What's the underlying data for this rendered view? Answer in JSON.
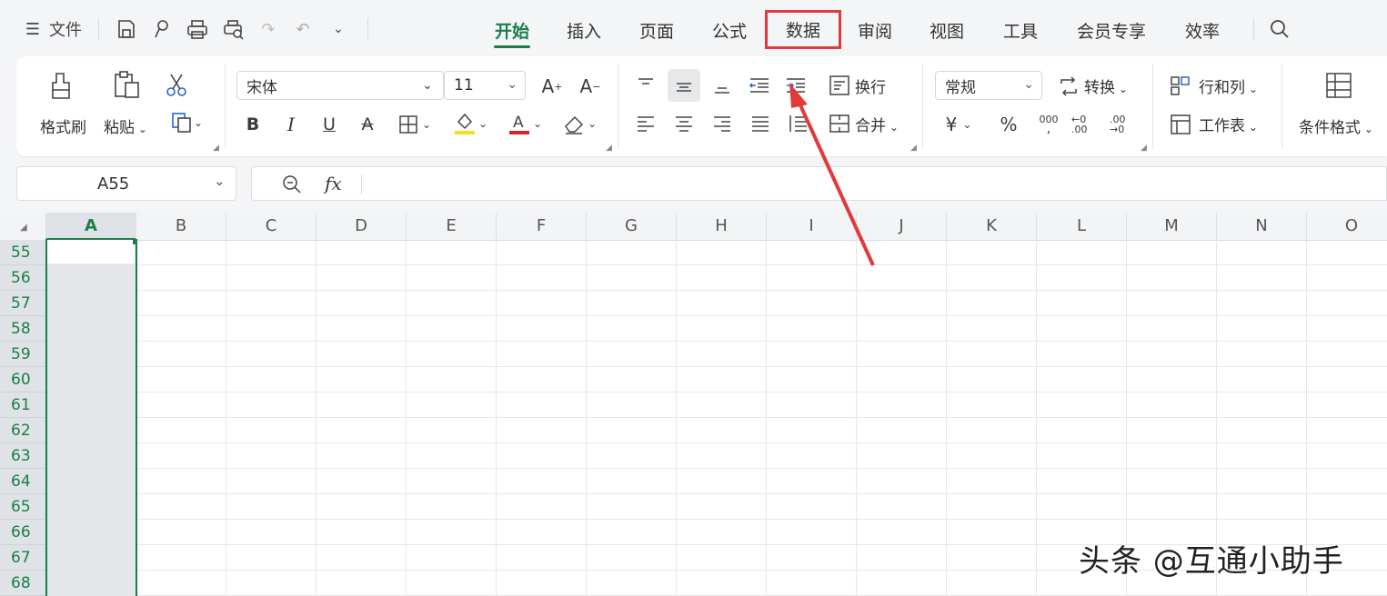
{
  "menu": {
    "file_label": "文件",
    "tabs": [
      "开始",
      "插入",
      "页面",
      "公式",
      "数据",
      "审阅",
      "视图",
      "工具",
      "会员专享",
      "效率"
    ],
    "active_tab": "开始",
    "highlighted_tab": "数据"
  },
  "ribbon": {
    "format_painter": "格式刷",
    "paste": "粘贴",
    "font_name": "宋体",
    "font_size": "11",
    "wrap_text": "换行",
    "merge": "合并",
    "number_format": "常规",
    "convert": "转换",
    "rows_cols": "行和列",
    "worksheet": "工作表",
    "conditional_format": "条件格式",
    "bold": "B",
    "italic": "I",
    "underline": "U",
    "currency": "¥",
    "percent": "%",
    "thousands": "000",
    "dec_increase": "←0 .00",
    "dec_decrease": ".00 →0"
  },
  "formula": {
    "cell_ref": "A55",
    "fx": "fx"
  },
  "sheet": {
    "columns": [
      "A",
      "B",
      "C",
      "D",
      "E",
      "F",
      "G",
      "H",
      "I",
      "J",
      "K",
      "L",
      "M",
      "N",
      "O"
    ],
    "rows": [
      "55",
      "56",
      "57",
      "58",
      "59",
      "60",
      "61",
      "62",
      "63",
      "64",
      "65",
      "66",
      "67",
      "68"
    ],
    "selected_column": "A"
  },
  "watermark": "头条 @互通小助手",
  "colors": {
    "accent": "#1a7f49",
    "highlight_box": "#e03a3a",
    "arrow": "#e03a3a"
  }
}
